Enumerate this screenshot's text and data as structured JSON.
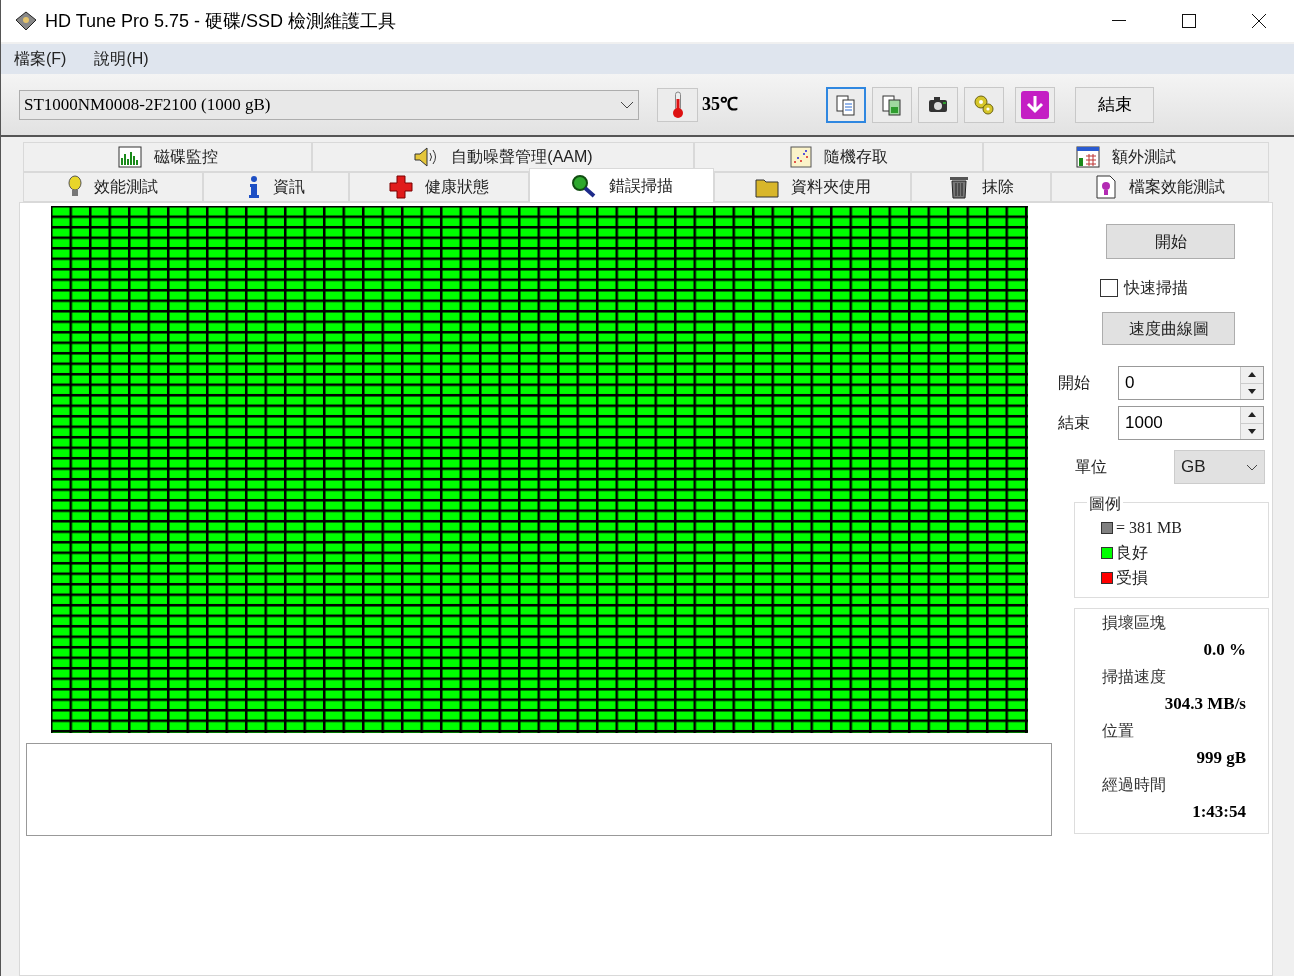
{
  "window": {
    "title": "HD Tune Pro 5.75 - 硬碟/SSD 檢測維護工具"
  },
  "menu": [
    "檔案(F)",
    "說明(H)"
  ],
  "drive_select": {
    "value": "ST1000NM0008-2F2100 (1000 gB)"
  },
  "temperature": "35℃",
  "toolbar_buttons": [
    {
      "kind": "copy-text",
      "selected": true
    },
    {
      "kind": "copy-image",
      "selected": false
    },
    {
      "kind": "camera",
      "selected": false
    },
    {
      "kind": "options",
      "selected": false
    },
    {
      "kind": "save",
      "selected": false
    }
  ],
  "exit_button": "結束",
  "tabs_top": [
    {
      "label": "磁碟監控",
      "kind": "monitor",
      "selected": false
    },
    {
      "label": "自動噪聲管理(AAM)",
      "kind": "speaker",
      "selected": false
    },
    {
      "label": "隨機存取",
      "kind": "scatter",
      "selected": false
    },
    {
      "label": "額外測試",
      "kind": "extra",
      "selected": false
    }
  ],
  "tabs_bottom": [
    {
      "label": "效能測試",
      "kind": "bulb",
      "selected": false
    },
    {
      "label": "資訊",
      "kind": "info",
      "selected": false
    },
    {
      "label": "健康狀態",
      "kind": "health",
      "selected": false
    },
    {
      "label": "錯誤掃描",
      "kind": "search",
      "selected": true
    },
    {
      "label": "資料夾使用",
      "kind": "folder",
      "selected": false
    },
    {
      "label": "抹除",
      "kind": "trash",
      "selected": false
    },
    {
      "label": "檔案效能測試",
      "kind": "file",
      "selected": false
    }
  ],
  "scan_map": {
    "damaged": false
  },
  "start_button": "開始",
  "quick_scan": {
    "label": "快速掃描",
    "checked": false
  },
  "speed_chart_button": "速度曲線圖",
  "range": [
    {
      "label": "開始",
      "value": "0"
    },
    {
      "label": "結束",
      "value": "1000"
    }
  ],
  "unit": {
    "label": "單位",
    "value": "GB"
  },
  "legend": {
    "title": "圖例",
    "items": [
      {
        "label": "= 381 MB",
        "color": "#808080"
      },
      {
        "label": "良好",
        "color": "#00ff00"
      },
      {
        "label": "受損",
        "color": "#ff0000"
      }
    ]
  },
  "stats": [
    {
      "label": "損壞區塊",
      "value": "0.0 %"
    },
    {
      "label": "掃描速度",
      "value": "304.3 MB/s"
    },
    {
      "label": "位置",
      "value": "999 gB"
    },
    {
      "label": "經過時間",
      "value": "1:43:54"
    }
  ]
}
